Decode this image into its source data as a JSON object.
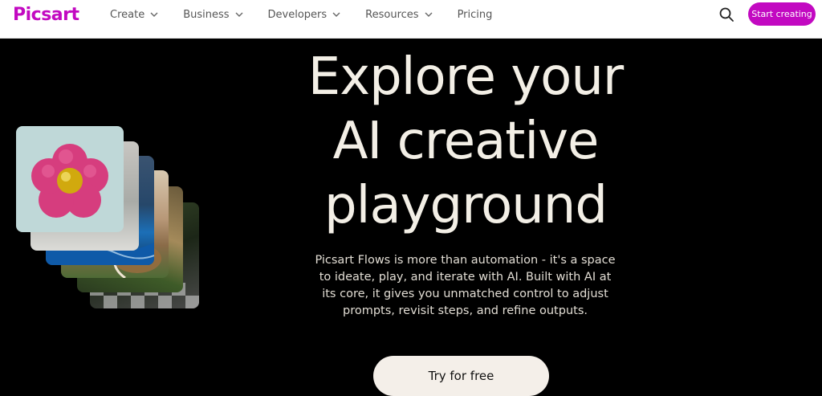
{
  "brand": {
    "logo": "Picsart",
    "accent": "#c209c1"
  },
  "nav": {
    "items": [
      {
        "label": "Create",
        "has_dropdown": true
      },
      {
        "label": "Business",
        "has_dropdown": true
      },
      {
        "label": "Developers",
        "has_dropdown": true
      },
      {
        "label": "Resources",
        "has_dropdown": true
      },
      {
        "label": "Pricing",
        "has_dropdown": false
      }
    ],
    "search_icon": "search-icon",
    "cta_label": "Start creating"
  },
  "hero": {
    "title_lines": [
      "Explore your",
      "AI creative",
      "playground"
    ],
    "description": "Picsart Flows is more than automation - it's a space to ideate, play, and iterate with AI. Built with AI at its core, it gives you unmatched control to adjust prompts, revisit steps, and refine outputs.",
    "cta_label": "Try for free"
  }
}
